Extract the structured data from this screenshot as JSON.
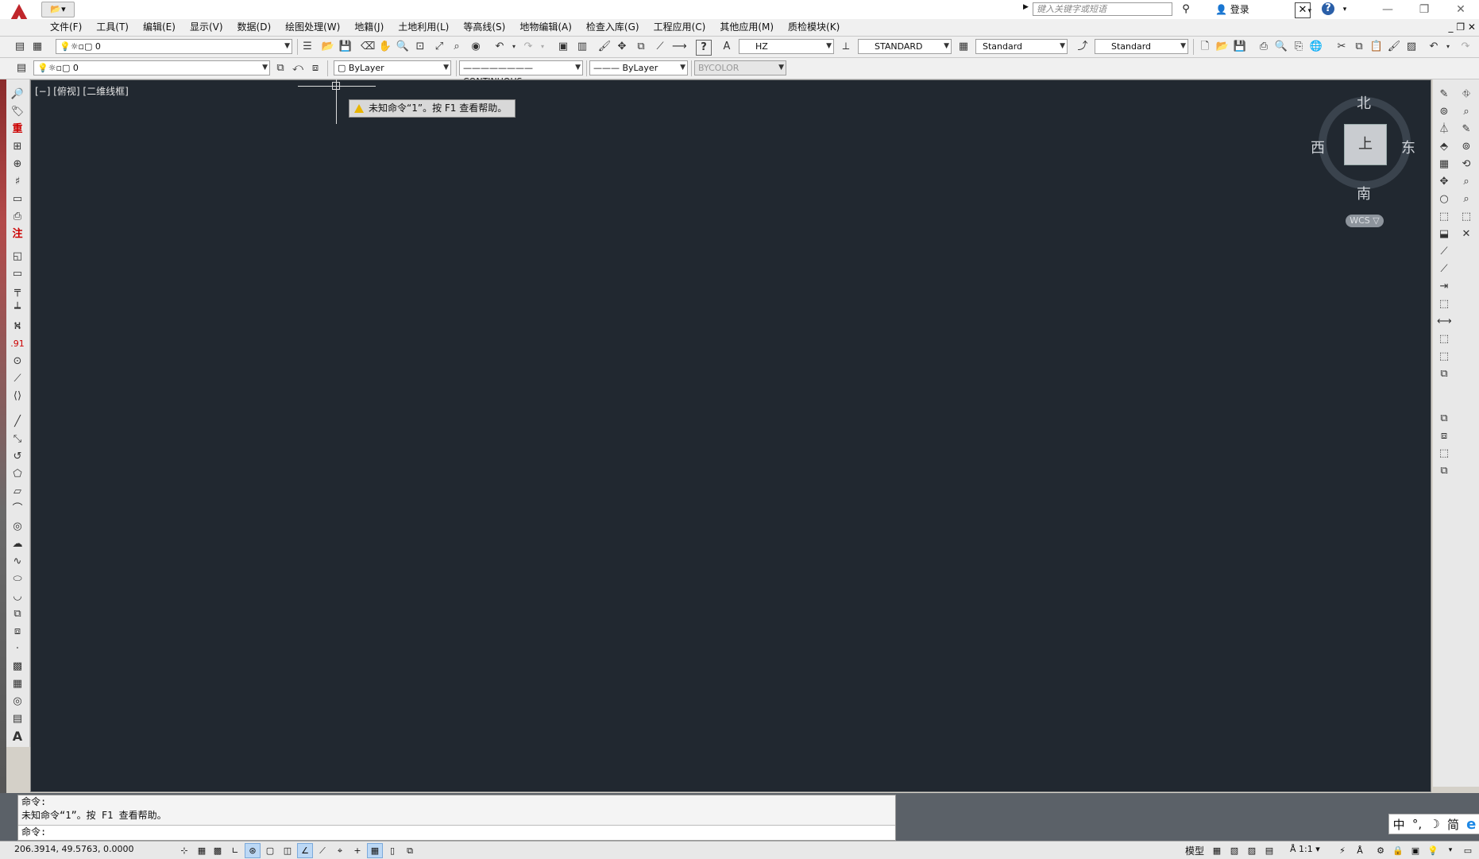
{
  "titlebar": {
    "search_placeholder": "键入关键字或短语",
    "login_label": "登录",
    "help_label": "?",
    "window_controls": [
      "—",
      "❐",
      "✕"
    ]
  },
  "menubar": {
    "items": [
      "文件(F)",
      "工具(T)",
      "编辑(E)",
      "显示(V)",
      "数据(D)",
      "绘图处理(W)",
      "地籍(J)",
      "土地利用(L)",
      "等高线(S)",
      "地物编辑(A)",
      "检查入库(G)",
      "工程应用(C)",
      "其他应用(M)",
      "质检模块(K)"
    ],
    "right_controls": "_ ❐ ✕"
  },
  "toolbar1": {
    "layer_value": "0",
    "text_style": "HZ",
    "dim_style": "STANDARD",
    "table_style": "Standard",
    "multileader_style": "Standard"
  },
  "toolbar2": {
    "layer_value": "0",
    "color_value": "ByLayer",
    "linetype_value": "CONTINUOUS",
    "lineweight_value": "ByLayer",
    "plotstyle_value": "BYCOLOR"
  },
  "viewport": {
    "label": "[−] [俯视] [二维线框]"
  },
  "compass": {
    "north": "北",
    "south": "南",
    "east": "东",
    "west": "西",
    "cube_face": "上",
    "wcs_label": "WCS ▽"
  },
  "tooltip": {
    "text": "未知命令“1”。按 F1 查看帮助。"
  },
  "command": {
    "line1": "命令:",
    "line2": "未知命令“1”。按 F1 查看帮助。",
    "prompt": "命令:"
  },
  "statusbar": {
    "coords": "206.3914,  49.5763,  0.0000",
    "model_label": "模型",
    "scale_label": "1:1"
  },
  "ime": {
    "lang": "中",
    "punct": "°,",
    "moon": "☽",
    "mode": "简"
  },
  "left_tool_labels": {
    "zhong": "重",
    "zhu": "注",
    "num": ".91",
    "text_A": "A"
  },
  "colors": {
    "canvas": "#212830",
    "accent_red": "#c0262b"
  }
}
